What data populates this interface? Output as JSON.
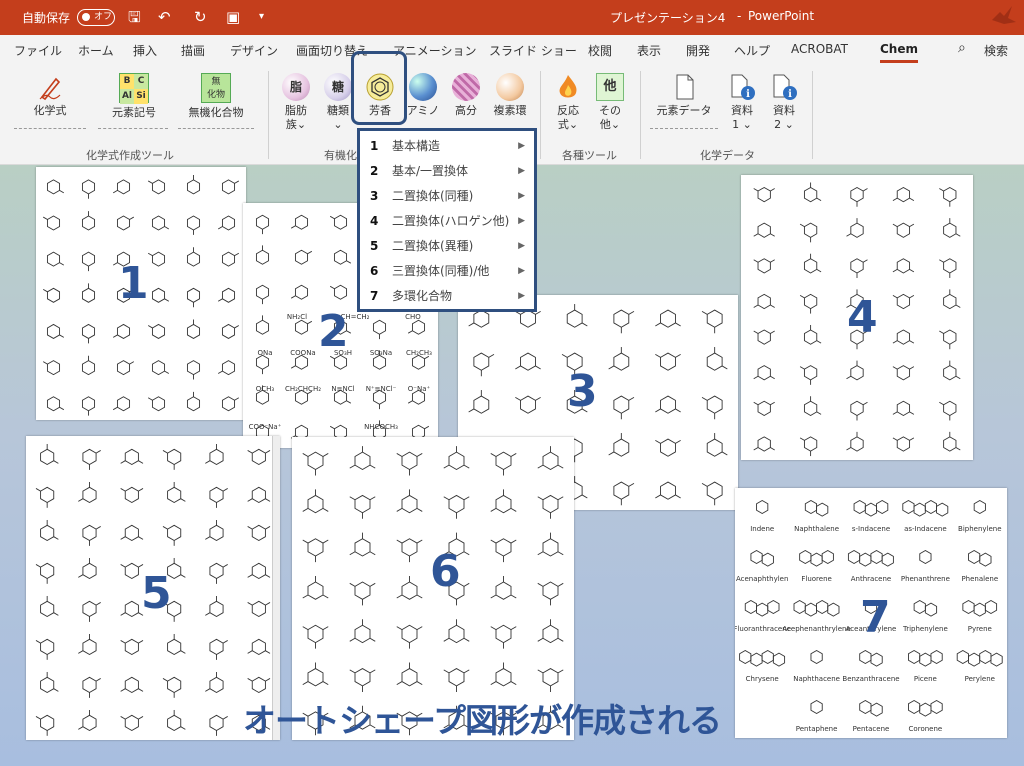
{
  "titlebar": {
    "autosave_label": "自動保存",
    "toggle_state": "オフ",
    "doc_title": "プレゼンテーション4",
    "separator": "-",
    "app_name": "PowerPoint"
  },
  "tabs": [
    "ファイル",
    "ホーム",
    "挿入",
    "描画",
    "デザイン",
    "画面切り替え",
    "アニメーション",
    "スライド ショー",
    "校閲",
    "表示",
    "開発",
    "ヘルプ",
    "ACROBAT",
    "Chem"
  ],
  "active_tab": "Chem",
  "search_label": "検索",
  "ribbon": {
    "formula": "化学式",
    "element_symbol": "元素記号",
    "element_icon": [
      "B",
      "C",
      "Al",
      "Si"
    ],
    "inorganic": "無機化合物",
    "inorganic_icon": [
      "無",
      "化物"
    ],
    "fat": "脂肪",
    "fat_sub": "族",
    "fat_icon": "脂",
    "sugar": "糖類",
    "sugar_icon": "糖",
    "aromatic": "芳香",
    "amino": "アミノ",
    "polymer": "高分",
    "heterocycle": "複素環",
    "reaction": "反応",
    "reaction_sub": "式",
    "other": "その",
    "other_sub": "他",
    "other_icon": "他",
    "element_data": "元素データ",
    "material1": "資料",
    "material1_sub": "1",
    "material2": "資料",
    "material2_sub": "2",
    "group_formula": "化学式作成ツール",
    "group_organic": "有機化",
    "group_tools": "各種ツール",
    "group_chemdata": "化学データ"
  },
  "menu": [
    {
      "num": "1",
      "label": "基本構造"
    },
    {
      "num": "2",
      "label": "基本/一置換体"
    },
    {
      "num": "3",
      "label": "二置換体(同種)"
    },
    {
      "num": "4",
      "label": "二置換体(ハロゲン他)"
    },
    {
      "num": "5",
      "label": "二置換体(異種)"
    },
    {
      "num": "6",
      "label": "三置換体(同種)/他"
    },
    {
      "num": "7",
      "label": "多環化合物"
    }
  ],
  "sheet_numbers": [
    "1",
    "2",
    "3",
    "4",
    "5",
    "6",
    "7"
  ],
  "sheet2_labels": [
    "NH₂Cl",
    "CH=CH₂",
    "CHO",
    "ONa",
    "COONa",
    "SO₃H",
    "SO₃Na",
    "CH₂CH₃",
    "OCH₃",
    "CH₂CHCH₂",
    "N≡NCl",
    "N⁺≡NCl⁻",
    "O⁻Na⁺",
    "COO⁻Na⁺",
    "NHCOCH₃"
  ],
  "sheet7_names": [
    "Indene",
    "Naphthalene",
    "s-Indacene",
    "as-Indacene",
    "Biphenylene",
    "Acenaphthylen",
    "Fluorene",
    "Anthracene",
    "Phenanthrene",
    "Phenalene",
    "Fluoranthracene",
    "Acephenanthrylene",
    "Aceanthrylene",
    "Triphenylene",
    "Pyrene",
    "Chrysene",
    "Naphthacene",
    "Benzanthracene",
    "Picene",
    "Perylene",
    "Pentaphene",
    "Pentacene",
    "Coronene"
  ],
  "footer_caption": "オートシェープ図形が作成される",
  "colors": {
    "titlebar": "#c43e1c",
    "accent": "#2f5597",
    "menu_border": "#2f4f7f"
  }
}
